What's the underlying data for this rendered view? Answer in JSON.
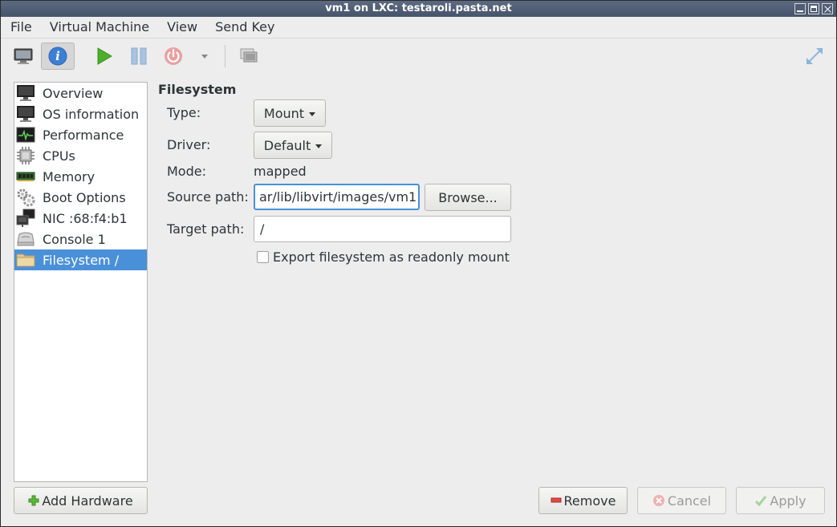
{
  "window": {
    "title": "vm1 on LXC: testaroli.pasta.net"
  },
  "menubar": {
    "items": [
      "File",
      "Virtual Machine",
      "View",
      "Send Key"
    ]
  },
  "toolbar": {
    "icons": [
      "console-icon",
      "details-info-icon",
      "run-icon",
      "pause-icon",
      "shutdown-icon",
      "shutdown-menu-arrow-icon",
      "snapshots-icon",
      "fullscreen-icon"
    ],
    "toggled": "details-info-icon"
  },
  "sidebar": {
    "items": [
      {
        "label": "Overview",
        "icon": "monitor-icon"
      },
      {
        "label": "OS information",
        "icon": "monitor-icon"
      },
      {
        "label": "Performance",
        "icon": "performance-graph-icon"
      },
      {
        "label": "CPUs",
        "icon": "cpu-chip-icon"
      },
      {
        "label": "Memory",
        "icon": "memory-module-icon"
      },
      {
        "label": "Boot Options",
        "icon": "gears-icon"
      },
      {
        "label": "NIC :68:f4:b1",
        "icon": "network-icon"
      },
      {
        "label": "Console 1",
        "icon": "serial-console-icon"
      },
      {
        "label": "Filesystem /",
        "icon": "folder-icon"
      }
    ],
    "selected_index": 8,
    "add_hardware_label": "Add Hardware"
  },
  "filesystem": {
    "title": "Filesystem",
    "type_label": "Type:",
    "type_value": "Mount",
    "driver_label": "Driver:",
    "driver_value": "Default",
    "mode_label": "Mode:",
    "mode_value": "mapped",
    "source_label": "Source path:",
    "source_value": "ar/lib/libvirt/images/vm1",
    "browse_label": "Browse...",
    "target_label": "Target path:",
    "target_value": "/",
    "readonly_label": "Export filesystem as readonly mount",
    "readonly_checked": false
  },
  "footer": {
    "remove_label": "Remove",
    "cancel_label": "Cancel",
    "apply_label": "Apply"
  },
  "colors": {
    "selection": "#4a90d9",
    "titlebar": "#4f5d75",
    "run_green": "#4caf2c",
    "shutdown_red": "#e05a5a"
  }
}
